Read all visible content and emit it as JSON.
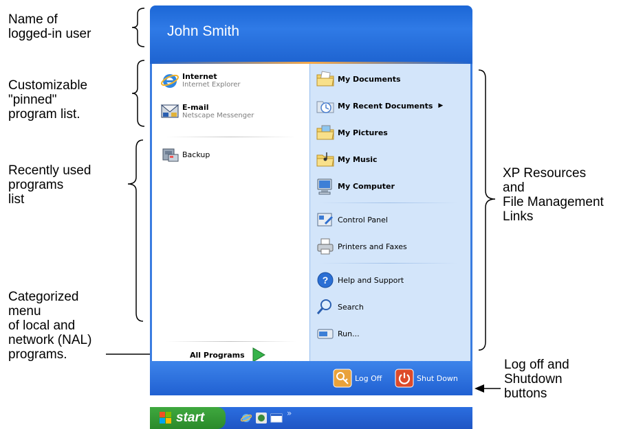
{
  "annotations": {
    "user": "Name of\nlogged-in user",
    "pinned": "Customizable\n\"pinned\"\nprogram list.",
    "recent": "Recently used\nprograms\nlist",
    "categorized": "Categorized\nmenu\nof local and\nnetwork (NAL)\nprograms.",
    "resources": "XP Resources\nand\nFile Management\nLinks",
    "logoff": "Log off and\nShutdown\nbuttons"
  },
  "start_menu": {
    "user_name": "John Smith",
    "pinned": [
      {
        "title": "Internet",
        "subtitle": "Internet Explorer",
        "icon": "internet-explorer-icon"
      },
      {
        "title": "E-mail",
        "subtitle": "Netscape Messenger",
        "icon": "email-icon"
      }
    ],
    "recent": [
      {
        "title": "Backup",
        "icon": "backup-icon"
      }
    ],
    "all_programs": "All Programs",
    "right_items": [
      {
        "label": "My Documents",
        "icon": "folder-documents-icon",
        "bold": true
      },
      {
        "label": "My Recent Documents",
        "icon": "recent-documents-icon",
        "bold": true,
        "submenu": true
      },
      {
        "label": "My Pictures",
        "icon": "folder-pictures-icon",
        "bold": true
      },
      {
        "label": "My Music",
        "icon": "folder-music-icon",
        "bold": true
      },
      {
        "label": "My Computer",
        "icon": "computer-icon",
        "bold": true
      },
      {
        "label": "Control Panel",
        "icon": "control-panel-icon",
        "bold": false
      },
      {
        "label": "Printers and Faxes",
        "icon": "printer-icon",
        "bold": false
      },
      {
        "label": "Help and Support",
        "icon": "help-icon",
        "bold": false
      },
      {
        "label": "Search",
        "icon": "search-icon",
        "bold": false
      },
      {
        "label": "Run...",
        "icon": "run-icon",
        "bold": false
      }
    ],
    "log_off": "Log Off",
    "shut_down": "Shut Down"
  },
  "taskbar": {
    "start": "start",
    "overflow": "»"
  },
  "colors": {
    "header_blue": "#1c67d6",
    "right_pane": "#d3e5fa",
    "start_green": "#3fa83f",
    "logoff_orange": "#e9a23b",
    "shutdown_red": "#dd4a2a"
  }
}
